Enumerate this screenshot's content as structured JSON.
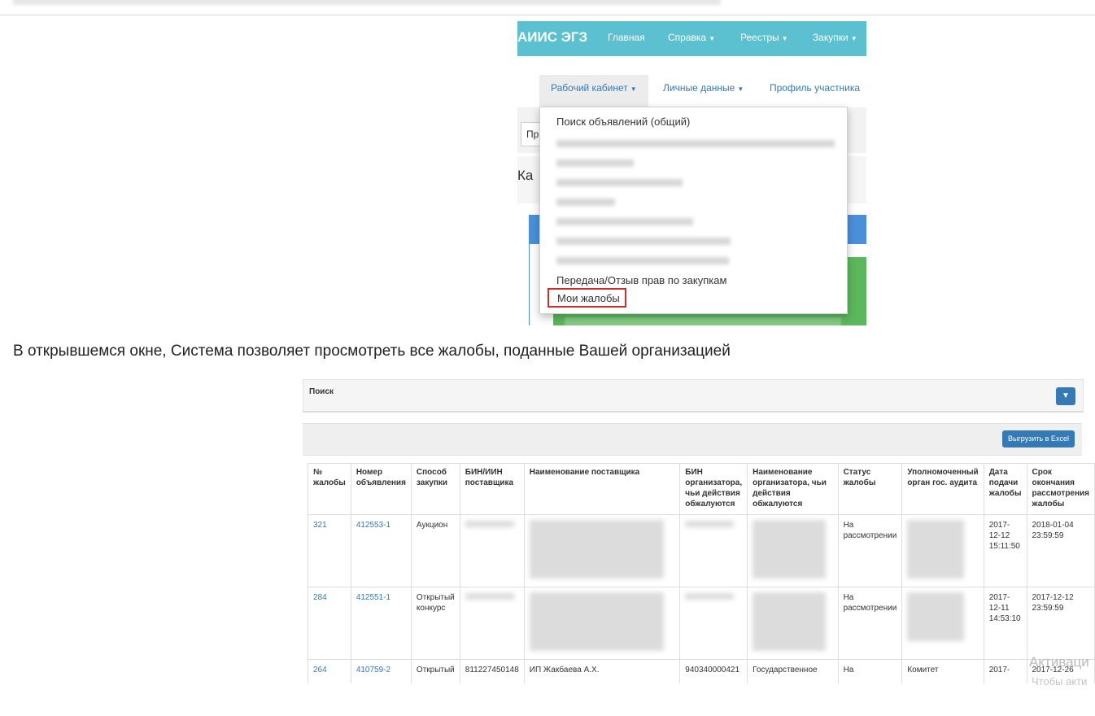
{
  "shot1": {
    "brand": "АИИС ЭГЗ",
    "nav": [
      "Главная",
      "Справка",
      "Реестры",
      "Закупки"
    ],
    "subnav": [
      "Рабочий кабинет",
      "Личные данные",
      "Профиль участника"
    ],
    "partial_button": "Пр",
    "partial_heading": "Ка",
    "dropdown": {
      "first_item": "Поиск объявлений (общий)",
      "transfer_item": "Передача/Отзыв прав по закупкам",
      "complaints_item": "Мои жалобы"
    },
    "caret": "▼"
  },
  "paragraph": "В открывшемся окне, Система позволяет просмотреть все жалобы, поданные Вашей организацией",
  "shot2": {
    "search_label": "Поиск",
    "collapse_icon": "chevron-down-icon",
    "excel_button": "Выгрузить в Excel",
    "headers": [
      "№ жалобы",
      "Номер объявления",
      "Способ закупки",
      "БИН/ИИН поставщика",
      "Наименование поставщика",
      "БИН организатора, чьи действия обжалуются",
      "Наименование организатора, чьи действия обжалуются",
      "Статус жалобы",
      "Уполномоченный орган гос. аудита",
      "Дата подачи жалобы",
      "Срок окончания рассмотрения жалобы"
    ],
    "rows": [
      {
        "num": "321",
        "ann": "412553-1",
        "method": "Аукцион",
        "bin": "",
        "supplier": "",
        "org_bin": "",
        "org_name": "",
        "status": "На рассмотрении",
        "audit": "",
        "date": "2017-12-12 15:11:50",
        "deadline": "2018-01-04 23:59:59"
      },
      {
        "num": "284",
        "ann": "412551-1",
        "method": "Открытый конкурс",
        "bin": "",
        "supplier": "",
        "org_bin": "",
        "org_name": "",
        "status": "На рассмотрении",
        "audit": "",
        "date": "2017-12-11 14:53:10",
        "deadline": "2017-12-12 23:59:59"
      },
      {
        "num": "264",
        "ann": "410759-2",
        "method": "Открытый",
        "bin": "811227450148",
        "supplier": "ИП Жакбаева А.Х.",
        "org_bin": "940340000421",
        "org_name": "Государственное",
        "status": "На",
        "audit": "Комитет",
        "date": "2017-",
        "deadline": "2017-12-26"
      }
    ]
  },
  "watermark": {
    "line1": "Активаци",
    "line2": "Чтобы акти"
  }
}
